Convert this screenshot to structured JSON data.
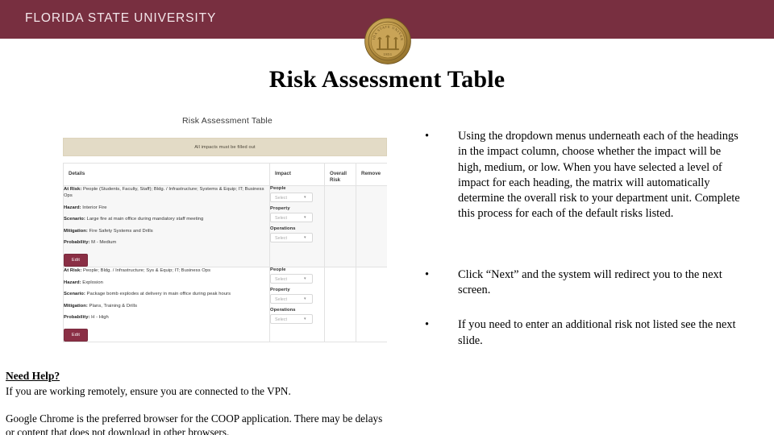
{
  "header": {
    "brand": "FLORIDA STATE UNIVERSITY",
    "brand_bg": "#782F40",
    "seal_label": "fsu-seal",
    "seal_outer_text": "FLORIDA STATE UNIVERSITY",
    "seal_year": "1851"
  },
  "slide": {
    "title": "Risk Assessment Table"
  },
  "app": {
    "heading": "Risk Assessment Table",
    "alert": "All impacts must be filled out",
    "alert_bg": "#e3dbc6",
    "columns": {
      "details": "Details",
      "impact": "Impact",
      "overall_risk_line1": "Overall",
      "overall_risk_line2": "Risk",
      "remove": "Remove"
    },
    "edit_button": "Edit",
    "edit_button_color": "#8a2f45",
    "impact_fields": {
      "people": "People",
      "property": "Property",
      "operations": "Operations",
      "placeholder": "Select",
      "chevron": "chevron-down-icon"
    },
    "rows": [
      {
        "labels": {
          "at_risk": "At Risk:",
          "hazard": "Hazard:",
          "scenario": "Scenario:",
          "mitigation": "Mitigation:",
          "probability": "Probability:"
        },
        "at_risk": "People (Students, Faculty, Staff); Bldg. / Infrastructure; Systems & Equip; IT; Business Ops",
        "hazard": "Interior Fire",
        "scenario": "Large fire at main office during mandatory staff meeting",
        "mitigation": "Fire Safety Systems and Drills",
        "probability": "M - Medium"
      },
      {
        "labels": {
          "at_risk": "At Risk:",
          "hazard": "Hazard:",
          "scenario": "Scenario:",
          "mitigation": "Mitigation:",
          "probability": "Probability:"
        },
        "at_risk": "People; Bldg. / Infrastructure; Sys & Equip; IT; Business Ops",
        "hazard": "Explosion",
        "scenario": "Package bomb explodes at delivery in main office during peak hours",
        "mitigation": "Plans, Training & Drills",
        "probability": "H - High"
      }
    ]
  },
  "bullets": [
    "Using the dropdown menus underneath each of the headings in the impact column, choose whether the impact will be high, medium, or low. When you have selected a level of impact for each heading, the matrix will automatically determine the overall risk to your department unit. Complete this process for each of the default risks listed.",
    "Click “Next” and the system will redirect you to the next screen.",
    "If you need to enter an additional risk not listed see the next slide."
  ],
  "bullet_marker": "•",
  "help": {
    "title": "Need Help?",
    "line1": "If you are working remotely, ensure you are connected to the VPN.",
    "line2": "Google Chrome is the preferred browser for the COOP application. There may be delays or content that does not download in other browsers."
  }
}
